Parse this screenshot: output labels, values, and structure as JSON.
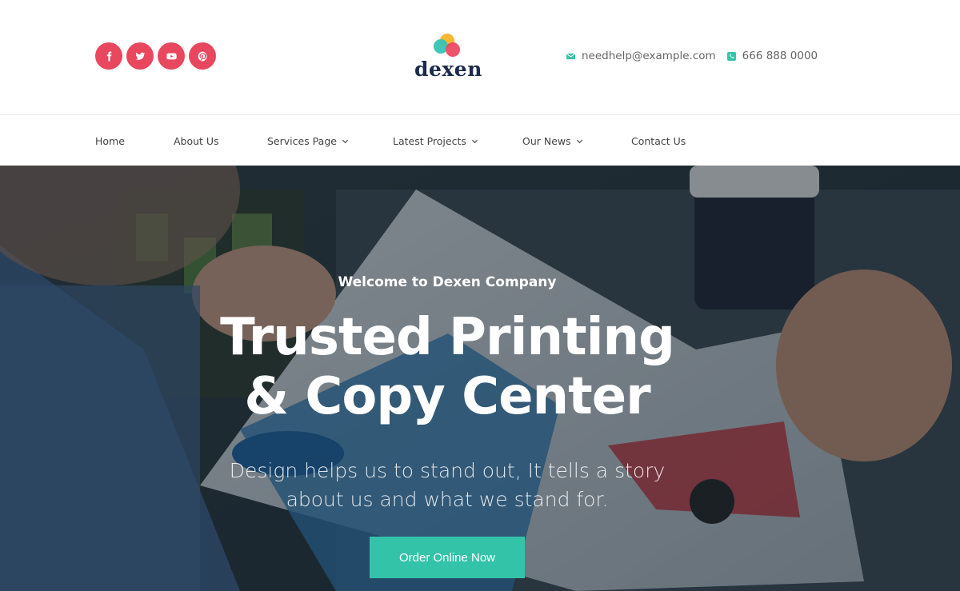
{
  "header": {
    "socials": [
      {
        "icon": "facebook-icon"
      },
      {
        "icon": "twitter-icon"
      },
      {
        "icon": "youtube-icon"
      },
      {
        "icon": "pinterest-icon"
      }
    ],
    "logo_text": "dexen",
    "email": "needhelp@example.com",
    "phone": "666 888 0000"
  },
  "nav": {
    "items": [
      {
        "label": "Home"
      },
      {
        "label": "About Us"
      },
      {
        "label": "Services Page"
      },
      {
        "label": "Latest Projects"
      },
      {
        "label": "Our News"
      },
      {
        "label": "Contact Us"
      }
    ]
  },
  "hero": {
    "eyebrow": "Welcome to Dexen Company",
    "headline_line1": "Trusted Printing",
    "headline_line2": "& Copy Center",
    "subline_line1": "Design helps us to stand out, It tells a story",
    "subline_line2": "about us and what we stand for.",
    "cta_label": "Order Online Now"
  },
  "colors": {
    "social_bg": "#e8475e",
    "accent": "#33c3a9",
    "logo_text": "#1b2b4b"
  }
}
